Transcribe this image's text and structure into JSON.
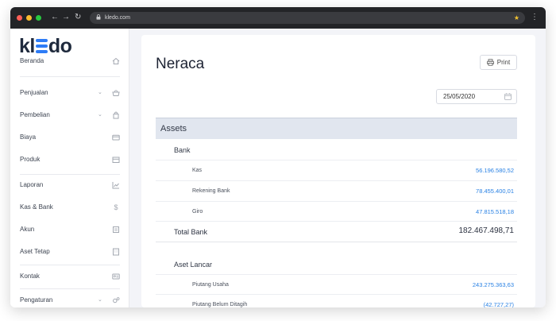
{
  "browser": {
    "url": "kledo.com"
  },
  "sidebar": {
    "logo": {
      "k": "kl",
      "rest": "do"
    },
    "items": [
      {
        "label": "Beranda",
        "icon": "home-icon",
        "chevron": false
      },
      {
        "label": "Penjualan",
        "icon": "basket-icon",
        "chevron": true
      },
      {
        "label": "Pembelian",
        "icon": "shopping-bag-icon",
        "chevron": true
      },
      {
        "label": "Biaya",
        "icon": "credit-card-icon",
        "chevron": false
      },
      {
        "label": "Produk",
        "icon": "box-icon",
        "chevron": false
      },
      {
        "label": "Laporan",
        "icon": "line-chart-icon",
        "chevron": false
      },
      {
        "label": "Kas & Bank",
        "icon": "dollar-icon",
        "chevron": false
      },
      {
        "label": "Akun",
        "icon": "ledger-icon",
        "chevron": false
      },
      {
        "label": "Aset Tetap",
        "icon": "building-icon",
        "chevron": false
      },
      {
        "label": "Kontak",
        "icon": "contact-card-icon",
        "chevron": false
      },
      {
        "label": "Pengaturan",
        "icon": "gears-icon",
        "chevron": true
      }
    ]
  },
  "main": {
    "title": "Neraca",
    "print_label": "Print",
    "date": "25/05/2020",
    "section": "Assets",
    "groups": [
      {
        "name": "Bank",
        "items": [
          {
            "label": "Kas",
            "value": "56.196.580,52"
          },
          {
            "label": "Rekening Bank",
            "value": "78.455.400,01"
          },
          {
            "label": "Giro",
            "value": "47.815.518,18"
          }
        ],
        "total_label": "Total Bank",
        "total_value": "182.467.498,71"
      },
      {
        "name": "Aset Lancar",
        "items": [
          {
            "label": "Piutang Usaha",
            "value": "243.275.363,63"
          },
          {
            "label": "Piutang Belum Ditagih",
            "value": "(42.727,27)"
          }
        ]
      }
    ]
  },
  "colors": {
    "accent": "#2e7cf6",
    "link_value": "#2a82e4",
    "section_band": "#e1e6ef"
  }
}
